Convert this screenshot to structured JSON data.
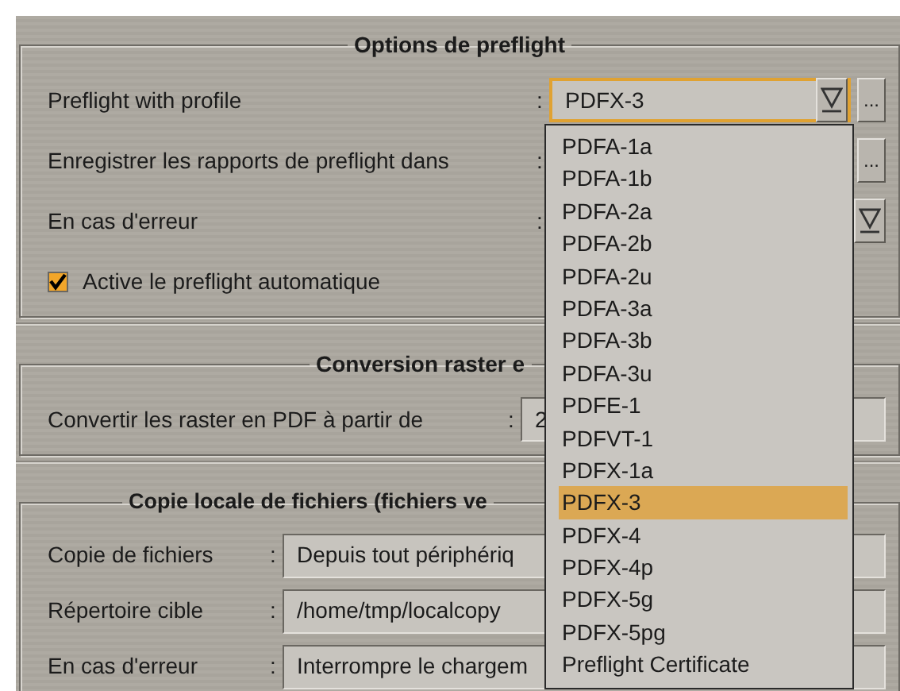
{
  "sections": [
    {
      "title": "Options de preflight",
      "rows": [
        {
          "kind": "combo-browse",
          "label": "Preflight with profile",
          "colon": ":",
          "value": "PDFX-3",
          "focused": true,
          "browse": "..."
        },
        {
          "kind": "browse",
          "label": "Enregistrer les rapports de preflight dans",
          "colon": ":",
          "browse": "..."
        },
        {
          "kind": "combo",
          "label": "En cas d'erreur",
          "colon": ":"
        },
        {
          "kind": "checkbox",
          "label": "Active le preflight automatique",
          "checked": true
        }
      ]
    },
    {
      "title": "Conversion raster e",
      "rows": [
        {
          "kind": "field",
          "label": "Convertir les raster en PDF à partir de",
          "colon": ":",
          "value": "2"
        }
      ]
    },
    {
      "title": "Copie locale de fichiers (fichiers ve",
      "rows": [
        {
          "kind": "field",
          "label": "Copie de fichiers",
          "colon": ":",
          "value": "Depuis tout périphériq"
        },
        {
          "kind": "field",
          "label": "Répertoire cible",
          "colon": ":",
          "value": "/home/tmp/localcopy"
        },
        {
          "kind": "field",
          "label": "En cas d'erreur",
          "colon": ":",
          "value": "Interrompre le chargem"
        }
      ]
    }
  ],
  "dropdown": {
    "items": [
      {
        "label": "PDFA-1a",
        "selected": false
      },
      {
        "label": "PDFA-1b",
        "selected": false
      },
      {
        "label": "PDFA-2a",
        "selected": false
      },
      {
        "label": "PDFA-2b",
        "selected": false
      },
      {
        "label": "PDFA-2u",
        "selected": false
      },
      {
        "label": "PDFA-3a",
        "selected": false
      },
      {
        "label": "PDFA-3b",
        "selected": false
      },
      {
        "label": "PDFA-3u",
        "selected": false
      },
      {
        "label": "PDFE-1",
        "selected": false
      },
      {
        "label": "PDFVT-1",
        "selected": false
      },
      {
        "label": "PDFX-1a",
        "selected": false
      },
      {
        "label": "PDFX-3",
        "selected": true
      },
      {
        "label": "PDFX-4",
        "selected": false
      },
      {
        "label": "PDFX-4p",
        "selected": false
      },
      {
        "label": "PDFX-5g",
        "selected": false
      },
      {
        "label": "PDFX-5pg",
        "selected": false
      },
      {
        "label": "Preflight Certificate",
        "selected": false
      }
    ]
  }
}
